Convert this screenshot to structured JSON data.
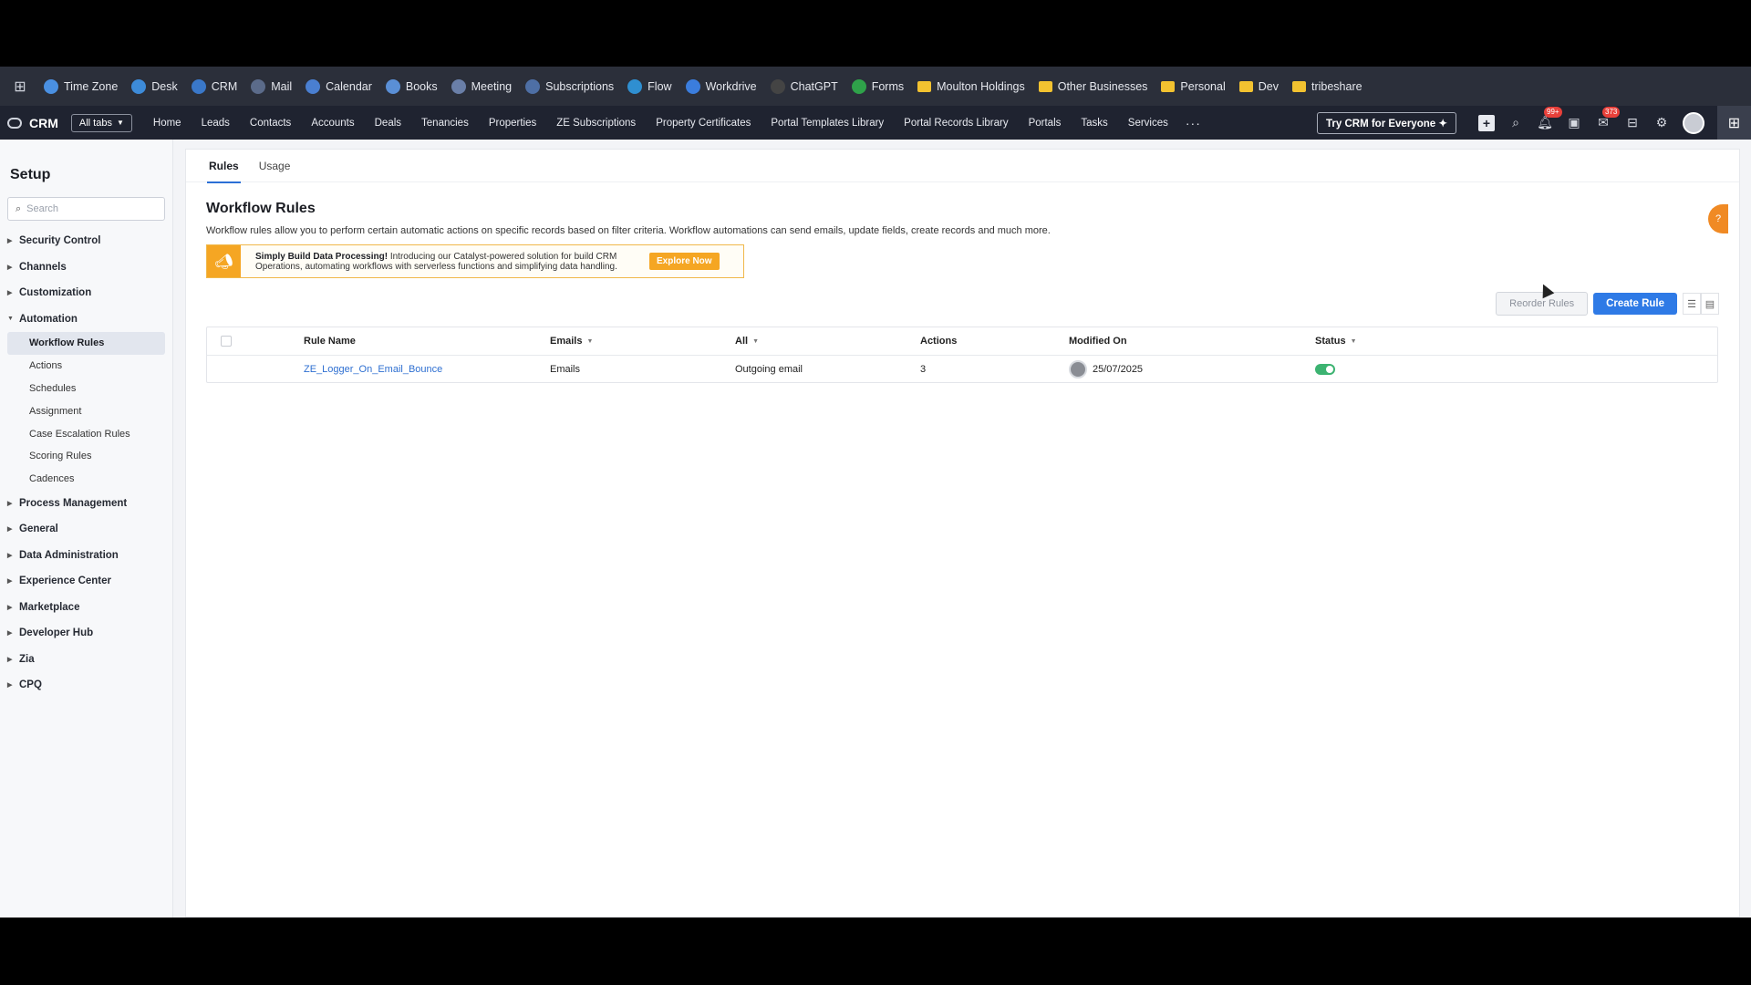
{
  "app_bar": {
    "items": [
      {
        "label": "Time Zone",
        "icon": "clock-icon",
        "color": "#4a90e2"
      },
      {
        "label": "Desk",
        "icon": "desk-icon",
        "color": "#3d8bd9"
      },
      {
        "label": "CRM",
        "icon": "crm-icon",
        "color": "#3a78c9"
      },
      {
        "label": "Mail",
        "icon": "mail-icon",
        "color": "#5b6b8a"
      },
      {
        "label": "Calendar",
        "icon": "calendar-icon",
        "color": "#4a7fd1"
      },
      {
        "label": "Books",
        "icon": "books-icon",
        "color": "#5a8fd6"
      },
      {
        "label": "Meeting",
        "icon": "meeting-icon",
        "color": "#6a7fa8"
      },
      {
        "label": "Subscriptions",
        "icon": "subscriptions-icon",
        "color": "#4e6fa5"
      },
      {
        "label": "Flow",
        "icon": "flow-icon",
        "color": "#2f8fd1"
      },
      {
        "label": "Workdrive",
        "icon": "workdrive-icon",
        "color": "#3b7ddd"
      },
      {
        "label": "ChatGPT",
        "icon": "chatgpt-icon",
        "color": "#444"
      },
      {
        "label": "Forms",
        "icon": "forms-icon",
        "color": "#2fa24a"
      }
    ],
    "folders": [
      "Moulton Holdings",
      "Other Businesses",
      "Personal",
      "Dev",
      "tribeshare"
    ]
  },
  "crm_nav": {
    "brand": "CRM",
    "all_tabs": "All tabs",
    "tabs": [
      "Home",
      "Leads",
      "Contacts",
      "Accounts",
      "Deals",
      "Tenancies",
      "Properties",
      "ZE Subscriptions",
      "Property Certificates",
      "Portal Templates Library",
      "Portal Records Library",
      "Portals",
      "Tasks",
      "Services"
    ],
    "more": "···",
    "try_button": "Try CRM for Everyone",
    "notif_badge": "99+",
    "mail_badge": "373"
  },
  "sidebar": {
    "title": "Setup",
    "search_placeholder": "Search",
    "groups_before": [
      "Security Control",
      "Channels",
      "Customization"
    ],
    "automation": {
      "label": "Automation",
      "items": [
        "Workflow Rules",
        "Actions",
        "Schedules",
        "Assignment",
        "Case Escalation Rules",
        "Scoring Rules",
        "Cadences"
      ],
      "active": "Workflow Rules"
    },
    "groups_after": [
      "Process Management",
      "General",
      "Data Administration",
      "Experience Center",
      "Marketplace",
      "Developer Hub",
      "Zia",
      "CPQ"
    ]
  },
  "content": {
    "tabs": [
      "Rules",
      "Usage"
    ],
    "title": "Workflow Rules",
    "description": "Workflow rules allow you to perform certain automatic actions on specific records based on filter criteria. Workflow automations can send emails, update fields, create records and much more.",
    "promo": {
      "bold": "Simply Build Data Processing!",
      "text": " Introducing our Catalyst-powered solution for build CRM Operations, automating workflows with serverless functions and simplifying data handling.",
      "button": "Explore Now"
    },
    "reorder_button": "Reorder Rules",
    "create_button": "Create Rule",
    "table": {
      "headers": {
        "name": "Rule Name",
        "module": "Emails",
        "filter": "All",
        "actions": "Actions",
        "modified": "Modified On",
        "status": "Status"
      },
      "rows": [
        {
          "name": "ZE_Logger_On_Email_Bounce",
          "module": "Emails",
          "trigger": "Outgoing email",
          "actions": "3",
          "modified": "25/07/2025",
          "status": "on"
        }
      ]
    }
  },
  "colors": {
    "accent": "#2e7ae6",
    "promo": "#f5a623",
    "status_on": "#3cb371"
  }
}
